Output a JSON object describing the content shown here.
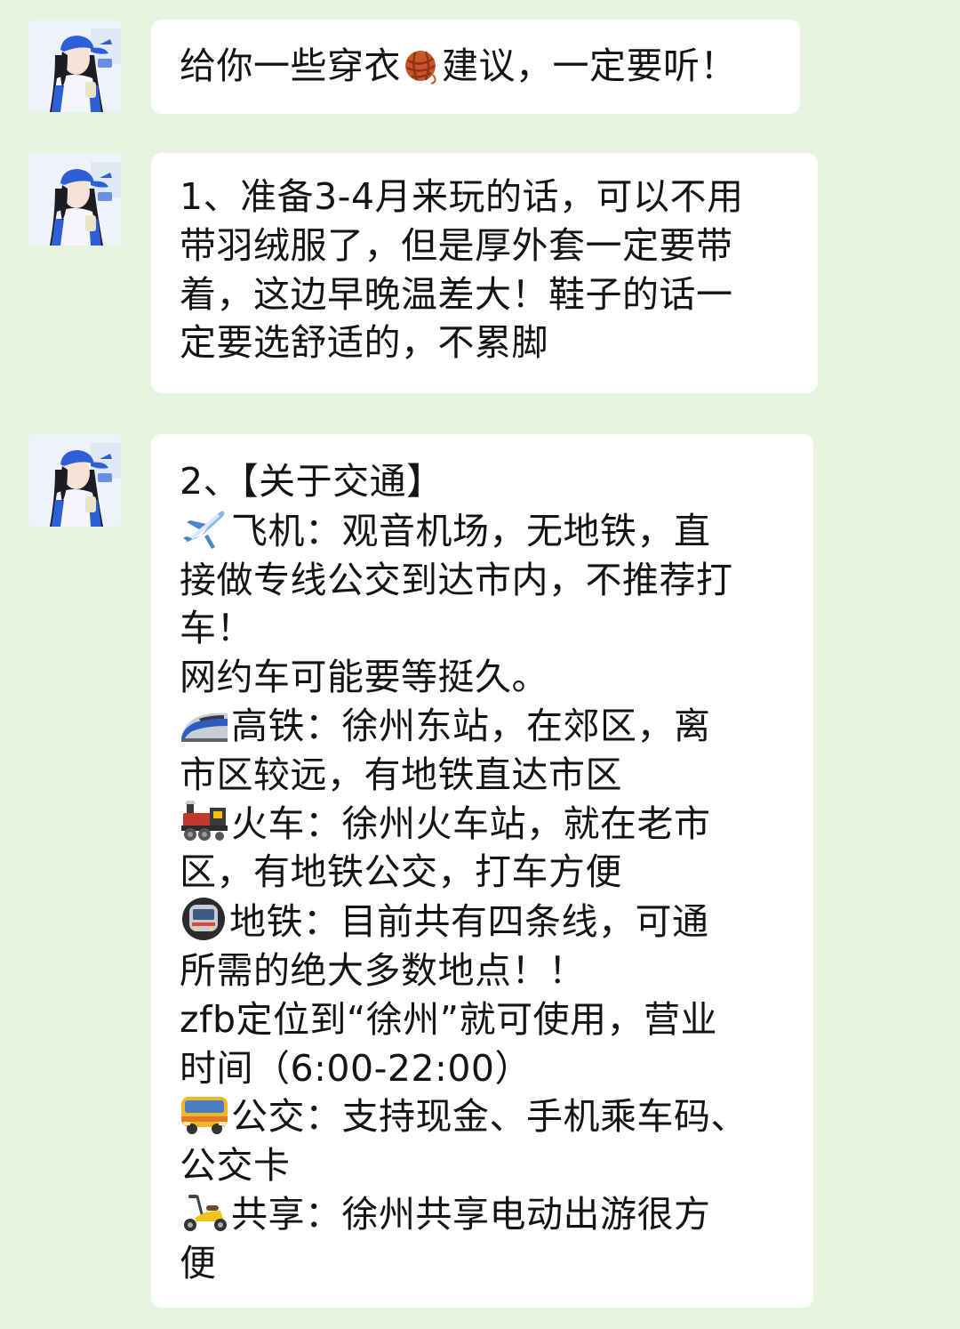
{
  "messages": [
    {
      "lines": [
        {
          "pre": "给你一些穿衣",
          "icon": "yarn-ball-icon",
          "post": "建议，一定要听！"
        }
      ]
    },
    {
      "lines": [
        {
          "text": "1、准备3-4月来玩的话，可以不用"
        },
        {
          "text": "带羽绒服了，但是厚外套一定要带"
        },
        {
          "text": "着，这边早晚温差大！鞋子的话一"
        },
        {
          "text": "定要选舒适的，不累脚"
        }
      ]
    },
    {
      "lines": [
        {
          "text": "2、【关于交通】"
        },
        {
          "icon": "airplane-icon",
          "text": "飞机：观音机场，无地铁，直"
        },
        {
          "text": "接做专线公交到达市内，不推荐打"
        },
        {
          "text": "车！"
        },
        {
          "text": "网约车可能要等挺久。"
        },
        {
          "icon": "bullet-train-icon",
          "text": "高铁：徐州东站，在郊区，离"
        },
        {
          "text": "市区较远，有地铁直达市区"
        },
        {
          "icon": "steam-locomotive-icon",
          "text": "火车：徐州火车站，就在老市"
        },
        {
          "text": "区，有地铁公交，打车方便"
        },
        {
          "icon": "metro-icon",
          "text": "地铁：目前共有四条线，可通"
        },
        {
          "text": "所需的绝大多数地点！！"
        },
        {
          "text": "zfb定位到“徐州”就可使用，营业"
        },
        {
          "text": "时间（6:00-22:00）"
        },
        {
          "icon": "bus-icon",
          "text": "公交：支持现金、手机乘车码、"
        },
        {
          "text": "公交卡"
        },
        {
          "icon": "scooter-icon",
          "text": "共享：徐州共享电动出游很方"
        },
        {
          "text": "便"
        }
      ]
    }
  ],
  "colors": {
    "background": "#e6f5e1",
    "bubble": "#ffffff",
    "text": "#141414",
    "cap": "#2f5fd6"
  }
}
